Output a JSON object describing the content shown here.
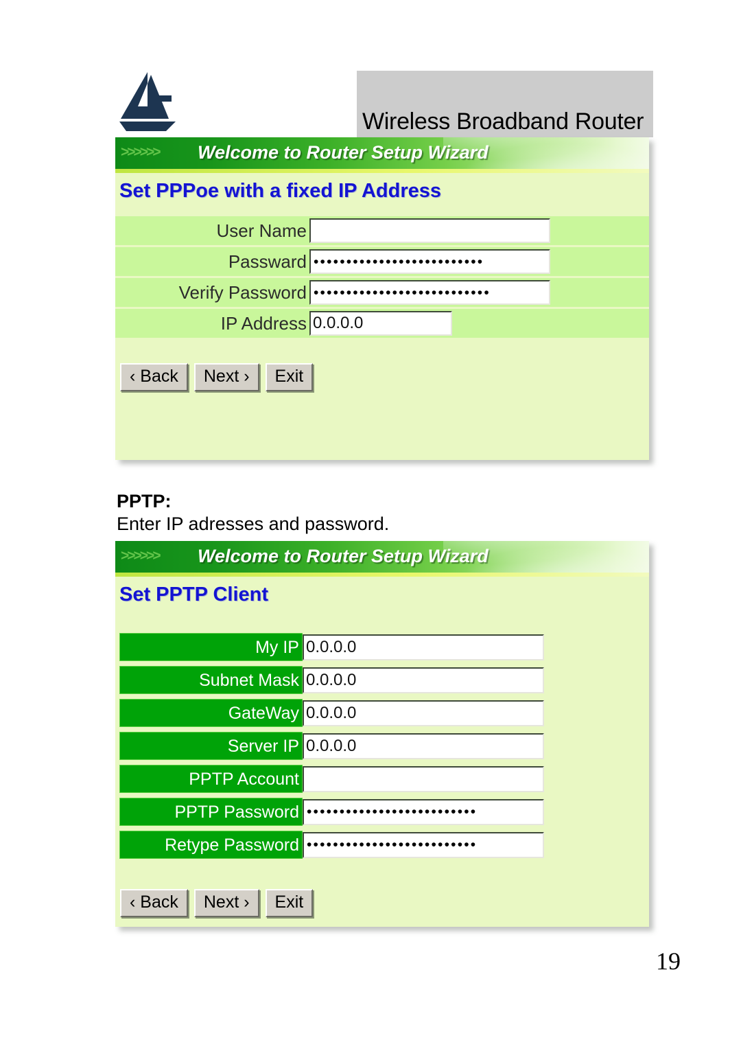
{
  "header": {
    "title": "Wireless Broadband Router",
    "logo_name": "atlantis-logo"
  },
  "pppoe_panel": {
    "banner_chevrons": ">>>>>>",
    "banner_title": "Welcome to Router Setup Wizard",
    "heading": "Set PPPoe with a fixed IP Address",
    "fields": [
      {
        "label": "User Name",
        "value": "",
        "type": "text"
      },
      {
        "label": "Passward",
        "value": "••••••••••••••••••••••••••",
        "type": "password"
      },
      {
        "label": "Verify Password",
        "value": "•••••••••••••••••••••••••••",
        "type": "password"
      },
      {
        "label": "IP Address",
        "value": "0.0.0.0",
        "type": "text"
      }
    ],
    "buttons": {
      "back": "‹ Back",
      "next": "Next ›",
      "exit": "Exit"
    }
  },
  "pptp_intro": {
    "title": "PPTP:",
    "text": "Enter IP adresses and password."
  },
  "pptp_panel": {
    "banner_chevrons": ">>>>>>",
    "banner_title": "Welcome to Router Setup Wizard",
    "heading": "Set PPTP Client",
    "fields": [
      {
        "label": "My IP",
        "value": "0.0.0.0",
        "type": "text"
      },
      {
        "label": "Subnet Mask",
        "value": "0.0.0.0",
        "type": "text"
      },
      {
        "label": "GateWay",
        "value": "0.0.0.0",
        "type": "text"
      },
      {
        "label": "Server IP",
        "value": "0.0.0.0",
        "type": "text"
      },
      {
        "label": "PPTP Account",
        "value": "",
        "type": "text"
      },
      {
        "label": "PPTP Password",
        "value": "••••••••••••••••••••••••••",
        "type": "password"
      },
      {
        "label": "Retype Password",
        "value": "••••••••••••••••••••••••••",
        "type": "password"
      }
    ],
    "buttons": {
      "back": "‹ Back",
      "next": "Next ›",
      "exit": "Exit"
    }
  },
  "footer": {
    "page_number": "19"
  },
  "colors": {
    "banner_green_dark": "#0e8a17",
    "banner_green_light": "#b7e88f",
    "panel_bg": "#e9f8c3",
    "row_green": "#c9f79b",
    "label_cell_green": "#00a308",
    "heading_blue": "#1414d2",
    "header_band_gray": "#cccccc",
    "logo_navy": "#1d3551"
  }
}
